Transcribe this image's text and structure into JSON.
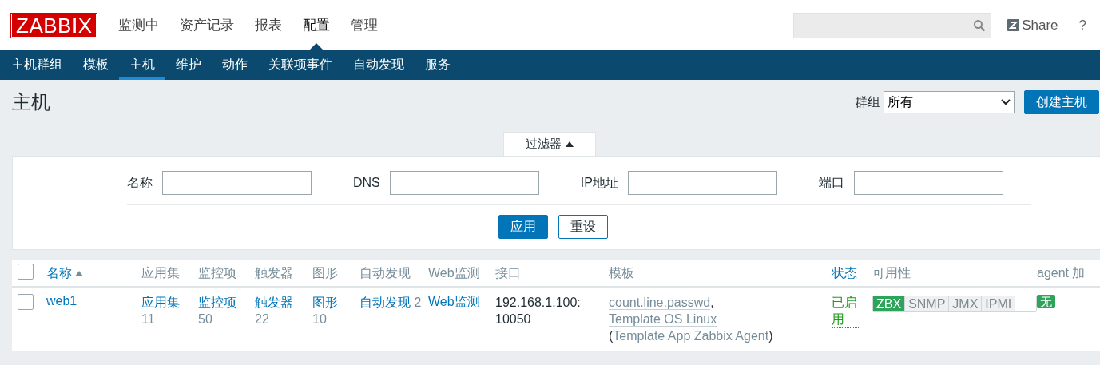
{
  "logo": "ZABBIX",
  "main_menu": [
    {
      "label": "监测中",
      "selected": false
    },
    {
      "label": "资产记录",
      "selected": false
    },
    {
      "label": "报表",
      "selected": false
    },
    {
      "label": "配置",
      "selected": true
    },
    {
      "label": "管理",
      "selected": false
    }
  ],
  "header_right": {
    "share": "Share",
    "help": "?"
  },
  "sub_menu": [
    {
      "label": "主机群组",
      "selected": false
    },
    {
      "label": "模板",
      "selected": false
    },
    {
      "label": "主机",
      "selected": true
    },
    {
      "label": "维护",
      "selected": false
    },
    {
      "label": "动作",
      "selected": false
    },
    {
      "label": "关联项事件",
      "selected": false
    },
    {
      "label": "自动发现",
      "selected": false
    },
    {
      "label": "服务",
      "selected": false
    }
  ],
  "page": {
    "title": "主机",
    "group_label": "群组",
    "group_value": "所有",
    "create_button": "创建主机"
  },
  "filter": {
    "tab": "过滤器",
    "expanded": true,
    "fields": [
      {
        "label": "名称"
      },
      {
        "label": "DNS"
      },
      {
        "label": "IP地址"
      },
      {
        "label": "端口"
      }
    ],
    "apply": "应用",
    "reset": "重设"
  },
  "table": {
    "select_all": false,
    "columns": [
      {
        "label": "名称",
        "kind": "sort",
        "sorted": true
      },
      {
        "label": "应用集",
        "kind": "plain"
      },
      {
        "label": "监控项",
        "kind": "plain"
      },
      {
        "label": "触发器",
        "kind": "plain"
      },
      {
        "label": "图形",
        "kind": "plain"
      },
      {
        "label": "自动发现",
        "kind": "plain"
      },
      {
        "label": "Web监测",
        "kind": "plain"
      },
      {
        "label": "接口",
        "kind": "plain"
      },
      {
        "label": "模板",
        "kind": "plain"
      },
      {
        "label": "状态",
        "kind": "sort",
        "sorted": false
      },
      {
        "label": "可用性",
        "kind": "plain"
      },
      {
        "label": "agent 加",
        "kind": "plain"
      }
    ],
    "rows": [
      {
        "checked": false,
        "name": "web1",
        "links": [
          {
            "label": "应用集",
            "count": "11"
          },
          {
            "label": "监控项",
            "count": "50"
          },
          {
            "label": "触发器",
            "count": "22"
          },
          {
            "label": "图形",
            "count": "10"
          },
          {
            "label": "自动发现",
            "count": "2"
          }
        ],
        "web": "Web监测",
        "interface": "192.168.1.100: 10050",
        "templates": [
          {
            "text": "count.line.passwd",
            "kind": "link"
          },
          {
            "text": ", ",
            "kind": "plain"
          },
          {
            "text": "Template OS Linux",
            "kind": "link"
          },
          {
            "text": " (",
            "kind": "plain"
          },
          {
            "text": "Template App Zabbix Agent",
            "kind": "link"
          },
          {
            "text": ")",
            "kind": "plain"
          }
        ],
        "status": "已启用",
        "enabled": true,
        "availability": [
          {
            "label": "ZBX",
            "available": true
          },
          {
            "label": "SNMP",
            "available": false
          },
          {
            "label": "JMX",
            "available": false
          },
          {
            "label": "IPMI",
            "available": false
          }
        ],
        "encryption": "无"
      }
    ]
  }
}
